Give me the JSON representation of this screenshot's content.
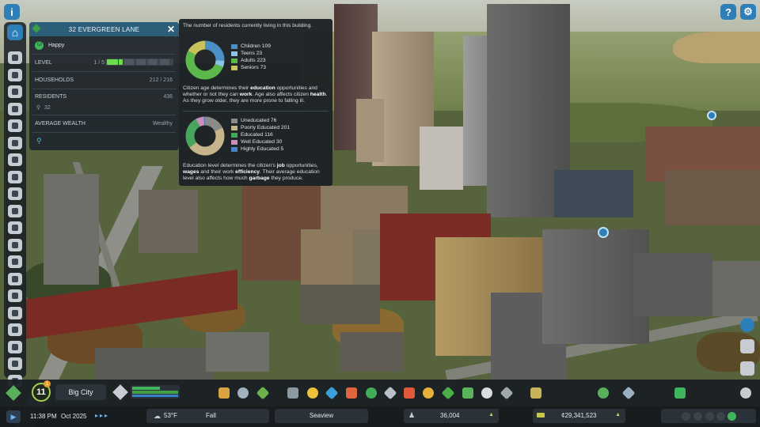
{
  "window": {
    "info_icon": "info-icon",
    "help_icon": "question-icon",
    "settings_icon": "gear-icon"
  },
  "info_panel": {
    "title": "32 EVERGREEN LANE",
    "status": "Happy",
    "level_label": "LEVEL",
    "level_value": "1 / 5",
    "households_label": "HOUSEHOLDS",
    "households_value": "212 / 216",
    "residents_label": "RESIDENTS",
    "residents_value": "436",
    "residents_sub": "32",
    "wealth_label": "AVERAGE WEALTH",
    "wealth_value": "Wealthy",
    "colors": {
      "header": "#2c5e7a",
      "level_fill": "#6bdc4a"
    }
  },
  "tooltip": {
    "intro": "The number of residents currently living in this building.",
    "age_legend": [
      {
        "label": "Children 109",
        "color": "#4a8fc6",
        "value": 109
      },
      {
        "label": "Teens 23",
        "color": "#8ec3e6",
        "value": 23
      },
      {
        "label": "Adults 223",
        "color": "#5cb84a",
        "value": 223
      },
      {
        "label": "Seniors 73",
        "color": "#c7c25a",
        "value": 73
      }
    ],
    "age_text_a": "Citizen age determines their ",
    "age_text_b": "education",
    "age_text_c": " opportunities and whether or not they can ",
    "age_text_d": "work",
    "age_text_e": ". Age also affects citizen ",
    "age_text_f": "health",
    "age_text_g": ". As they grow older, they are more prone to falling ill.",
    "edu_legend": [
      {
        "label": "Uneducated 76",
        "color": "#8a8a86",
        "value": 76
      },
      {
        "label": "Poorly Educated 201",
        "color": "#c6b48b",
        "value": 201
      },
      {
        "label": "Educated 116",
        "color": "#46a65b",
        "value": 116
      },
      {
        "label": "Well Educated 30",
        "color": "#c98fb8",
        "value": 30
      },
      {
        "label": "Highly Educated 5",
        "color": "#4a82c6",
        "value": 5
      }
    ],
    "edu_text_a": "Education level determines the citizen's ",
    "edu_text_b": "job",
    "edu_text_c": " opportunities, ",
    "edu_text_d": "wages",
    "edu_text_e": " and their work ",
    "edu_text_f": "efficiency",
    "edu_text_g": ". Their average education level also affects how much ",
    "edu_text_h": "garbage",
    "edu_text_i": " they produce."
  },
  "toolbar": {
    "city_name": "Big City",
    "milestone_level": "11",
    "milestone_badge": "1",
    "tools": [
      {
        "icon": "zoning-icon",
        "color": "#d9a441"
      },
      {
        "icon": "area-icon",
        "color": "#9fb2bd"
      },
      {
        "icon": "landscaping-icon",
        "color": "#6ab34a"
      },
      {
        "icon": "roads-icon",
        "color": "#8e9aa2"
      },
      {
        "icon": "electricity-icon",
        "color": "#f0c23a"
      },
      {
        "icon": "water-icon",
        "color": "#3aa0d9"
      },
      {
        "icon": "healthcare-icon",
        "color": "#e0643d"
      },
      {
        "icon": "garbage-icon",
        "color": "#3fae56"
      },
      {
        "icon": "education-icon",
        "color": "#b8c2c8"
      },
      {
        "icon": "fire-icon",
        "color": "#e05a3a"
      },
      {
        "icon": "police-icon",
        "color": "#e6b03a"
      },
      {
        "icon": "transport-icon",
        "color": "#4ab04a"
      },
      {
        "icon": "parks-icon",
        "color": "#58b35a"
      },
      {
        "icon": "communications-icon",
        "color": "#d9dde0"
      },
      {
        "icon": "signature-icon",
        "color": "#a0a8ae"
      },
      {
        "icon": "landmark-icon",
        "color": "#c9b25a"
      },
      {
        "icon": "map-tiles-icon",
        "color": "#5ab05a"
      },
      {
        "icon": "economy-icon",
        "color": "#9ab0c0"
      },
      {
        "icon": "progression-icon",
        "color": "#3fb65b"
      },
      {
        "icon": "photo-mode-icon",
        "color": "#c6ccd2"
      }
    ]
  },
  "status_bar": {
    "time": "11:38 PM",
    "date": "Oct 2025",
    "temperature": "53°F",
    "season": "Fall",
    "district": "Seaview",
    "population": "36,004",
    "money": "¢29,341,523"
  },
  "right_icons": {
    "radio_icon": "radio-icon",
    "citizens_icon": "citizens-icon",
    "chirper_icon": "chirper-icon"
  }
}
